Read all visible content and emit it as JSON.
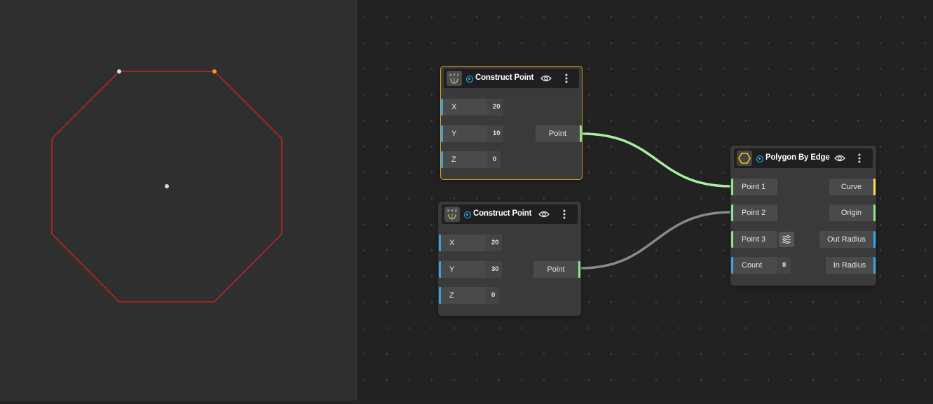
{
  "viewport": {
    "shape": "octagon",
    "stroke_color": "#cc2222",
    "point_colors": [
      "#dddddd",
      "#e8a020"
    ]
  },
  "canvas": {
    "nodes": [
      {
        "id": "construct-point-1",
        "title": "Construct Point",
        "icon": "xyz-axes-icon",
        "icon_text": "X Y Z",
        "selected": true,
        "inputs": [
          {
            "label": "X",
            "value": "20"
          },
          {
            "label": "Y",
            "value": "10"
          },
          {
            "label": "Z",
            "value": "0"
          }
        ],
        "output": "Point"
      },
      {
        "id": "construct-point-2",
        "title": "Construct Point",
        "icon": "xyz-axes-icon",
        "icon_text": "X Y Z",
        "selected": false,
        "inputs": [
          {
            "label": "X",
            "value": "20"
          },
          {
            "label": "Y",
            "value": "30"
          },
          {
            "label": "Z",
            "value": "0"
          }
        ],
        "output": "Point"
      },
      {
        "id": "polygon-by-edge",
        "title": "Polygon By Edge",
        "icon": "hexagon-icon",
        "selected": false,
        "inputs": [
          {
            "label": "Point 1",
            "value": ""
          },
          {
            "label": "Point 2",
            "value": ""
          },
          {
            "label": "Point 3",
            "value": ""
          },
          {
            "label": "Count",
            "value": "8"
          }
        ],
        "outputs": [
          "Curve",
          "Origin",
          "Out Radius",
          "In Radius"
        ]
      }
    ],
    "wires": [
      {
        "from": "construct-point-1.Point",
        "to": "polygon-by-edge.Point 1",
        "color": "#a8f0a0"
      },
      {
        "from": "construct-point-2.Point",
        "to": "polygon-by-edge.Point 2",
        "color": "#8a8a8a"
      }
    ]
  },
  "colors": {
    "accent_selected": "#d4a21c",
    "port_blue": "#3aa0e8",
    "port_green": "#8fe08f",
    "port_yellow": "#f2e34a"
  }
}
